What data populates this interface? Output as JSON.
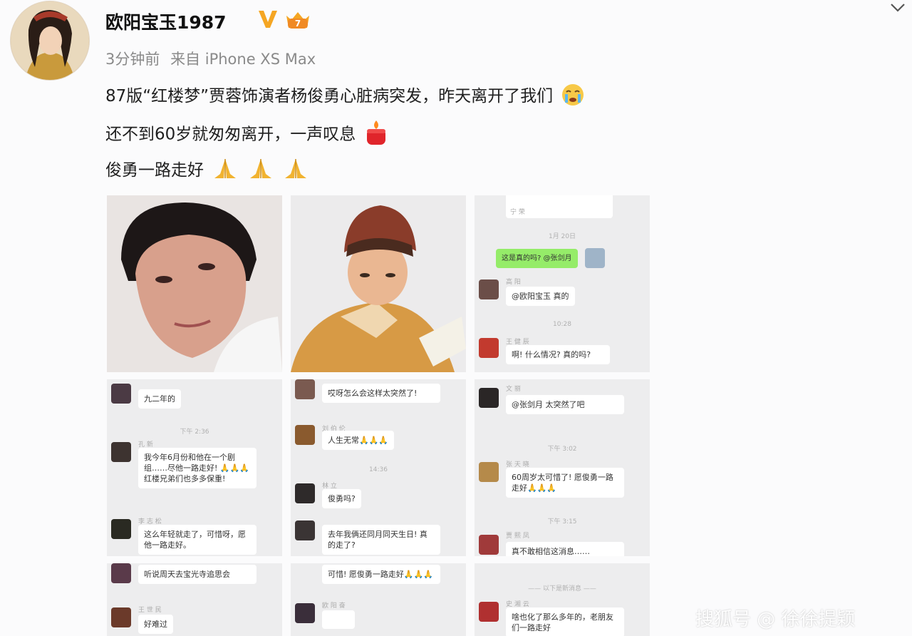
{
  "post": {
    "username": "欧阳宝玉1987",
    "time": "3分钟前",
    "source_prefix": "来自",
    "device": "iPhone XS Max",
    "line1": "87版“红楼梦”贾蓉饰演者杨俊勇心脏病突发，昨天离开了我们",
    "line2": "还不到60岁就匆匆离开，一声叹息",
    "line3": "俊勇一路走好"
  },
  "grid": {
    "cell3": {
      "top_name": "宁 荣",
      "time": "1月 20日",
      "outgoing": "这是真的吗? @张剑月",
      "m1_name": "高 阳",
      "m1_text": "@欧阳宝玉 真的",
      "time2": "10:28",
      "m2_name": "王 健 辰",
      "m2_text": "啊! 什么情况? 真的吗?"
    },
    "cell4": {
      "m1_text": "九二年的",
      "time": "下午 2:36",
      "m2_name": "孔 新",
      "m2_text": "我今年6月份和他在一个剧组……尽他一路走好! 🙏🙏🙏 红楼兄弟们也多多保重!",
      "m3_name": "李 志 松",
      "m3_text": "这么年轻就走了，可惜呀，愿他一路走好。"
    },
    "cell5": {
      "m1_text": "哎呀怎么会这样太突然了!",
      "m2_name": "刘 伯 伦",
      "m2_text": "人生无常🙏🙏🙏",
      "time": "14:36",
      "m3_name": "林 立",
      "m3_text": "俊勇吗?",
      "m4_text": "去年我俩还同月同天生日! 真的走了?"
    },
    "cell6": {
      "m1_name": "文 丽",
      "m1_text": "@张剑月 太突然了吧",
      "time": "下午 3:02",
      "m2_name": "张 天 晓",
      "m2_text": "60周岁太可惜了! 愿俊勇一路走好🙏🙏🙏",
      "time2": "下午 3:15",
      "m3_name": "贾 熙 凤",
      "m3_text": "真不敢相信这消息……"
    },
    "cell7": {
      "m1_text": "听说周天去宝光寺追思会",
      "m2_name": "王 世 民",
      "m2_text": "好难过"
    },
    "cell8": {
      "m1_text": "可惜! 愿俊勇一路走好🙏🙏🙏",
      "m2_name": "欧 阳 奋"
    },
    "cell9": {
      "time": "—— 以下是新消息 ——",
      "m1_name": "史 湘 云",
      "m1_text": "啥也化了那么多年的，老朋友们一路走好"
    }
  },
  "watermark": "搜狐号 @ 徐徐提颖",
  "colors": {
    "background": "#fbfbfc",
    "verified_v": "#f5a623",
    "wechat_green": "#95ec69",
    "meta_gray": "#8a8a8a"
  }
}
